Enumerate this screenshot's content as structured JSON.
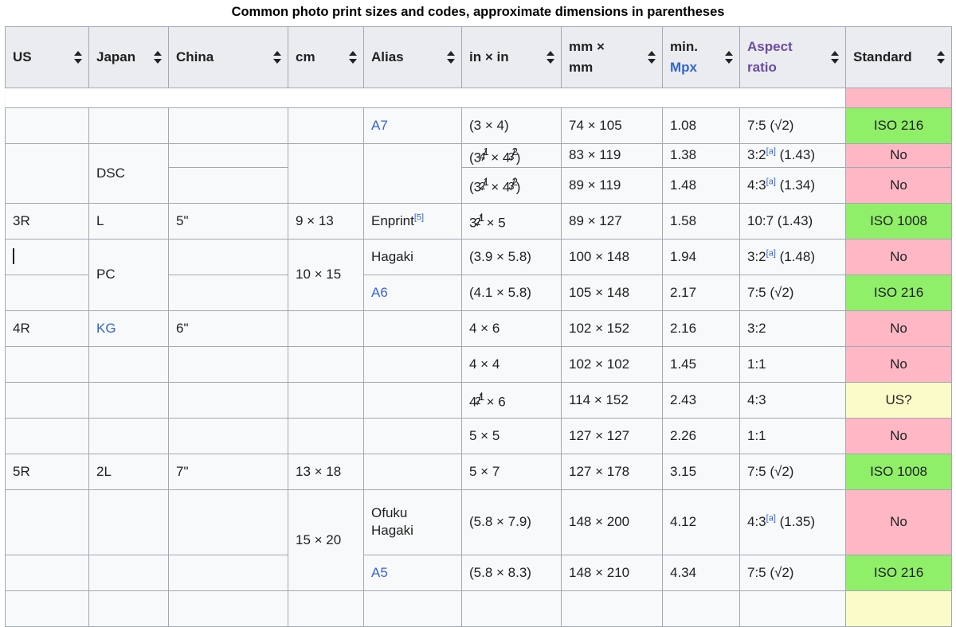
{
  "caption": "Common photo print sizes and codes, approximate dimensions in parentheses",
  "colors": {
    "header_bg": "#eaecf0",
    "cell_bg": "#f8f9fa",
    "border": "#a2a9b1",
    "link": "#3366cc",
    "link_visited": "#6b4ba1",
    "standard_yes": "#90ef69",
    "standard_no": "#ffb7c5",
    "standard_maybe": "#fbfbc9"
  },
  "headers": [
    {
      "label": "US",
      "sortable": true,
      "link": false
    },
    {
      "label": "Japan",
      "sortable": true,
      "link": false
    },
    {
      "label": "China",
      "sortable": true,
      "link": false
    },
    {
      "label": "cm",
      "sortable": true,
      "link": false
    },
    {
      "label": "Alias",
      "sortable": true,
      "link": false
    },
    {
      "label": "in × in",
      "sortable": true,
      "link": false
    },
    {
      "label": "mm × mm",
      "sortable": true,
      "link": false
    },
    {
      "label": "min. Mpx",
      "sortable": true,
      "link": "Mpx"
    },
    {
      "label": "Aspect ratio",
      "sortable": true,
      "link": "Aspect ratio"
    },
    {
      "label": "Standard",
      "sortable": true,
      "link": false
    }
  ],
  "header_parts": {
    "mm_line1": "mm ×",
    "mm_line2": "mm",
    "mpx_line1": "min.",
    "mpx_line2": "Mpx",
    "aspect_line1": "Aspect",
    "aspect_line2": "ratio"
  },
  "rows": [
    {
      "us": "",
      "japan": "",
      "china": "",
      "cm": "",
      "alias": "A7",
      "alias_link": true,
      "inin": "(3 × 4)",
      "mmmm": "74 × 105",
      "mpx": "1.08",
      "aspect": "7:5 (√2)",
      "standard": "ISO 216",
      "standard_state": "yes"
    },
    {
      "us": "",
      "japan": "DSC",
      "china": "",
      "cm": "",
      "alias": "",
      "inin": "(3¼ × 4⅔)",
      "mmmm": "83 × 119",
      "mpx": "1.38",
      "aspect": "3:2[a] (1.43)",
      "aspect_ref": "a",
      "standard": "No",
      "standard_state": "no"
    },
    {
      "us": "",
      "japan": "",
      "china": "",
      "cm": "",
      "alias": "",
      "inin": "(3½ × 4⅔)",
      "mmmm": "89 × 119",
      "mpx": "1.48",
      "aspect": "4:3[a] (1.34)",
      "aspect_ref": "a",
      "standard": "No",
      "standard_state": "no"
    },
    {
      "us": "3R",
      "japan": "L",
      "china": "5\"",
      "cm": "9 × 13",
      "alias": "Enprint",
      "alias_ref": "5",
      "inin": "3½ × 5",
      "mmmm": "89 × 127",
      "mpx": "1.58",
      "aspect": "10:7 (1.43)",
      "standard": "ISO 1008",
      "standard_state": "yes"
    },
    {
      "us": "",
      "us_caret": true,
      "japan": "PC",
      "china": "",
      "cm": "",
      "alias": "Hagaki",
      "inin": "(3.9 × 5.8)",
      "mmmm": "100 × 148",
      "mpx": "1.94",
      "aspect": "3:2[a] (1.48)",
      "aspect_ref": "a",
      "standard": "No",
      "standard_state": "no"
    },
    {
      "us": "",
      "japan": "",
      "china": "",
      "cm": "10 × 15",
      "alias": "A6",
      "alias_link": true,
      "inin": "(4.1 × 5.8)",
      "mmmm": "105 × 148",
      "mpx": "2.17",
      "aspect": "7:5 (√2)",
      "standard": "ISO 216",
      "standard_state": "yes"
    },
    {
      "us": "4R",
      "japan": "KG",
      "japan_link": true,
      "china": "6\"",
      "cm": "",
      "alias": "",
      "inin": "4 × 6",
      "mmmm": "102 × 152",
      "mpx": "2.16",
      "aspect": "3:2",
      "standard": "No",
      "standard_state": "no"
    },
    {
      "us": "",
      "japan": "",
      "china": "",
      "cm": "",
      "alias": "",
      "inin": "4 × 4",
      "mmmm": "102 × 102",
      "mpx": "1.45",
      "aspect": "1:1",
      "standard": "No",
      "standard_state": "no"
    },
    {
      "us": "",
      "japan": "",
      "china": "",
      "cm": "",
      "alias": "",
      "inin": "4½ × 6",
      "mmmm": "114 × 152",
      "mpx": "2.43",
      "aspect": "4:3",
      "standard": "US?",
      "standard_state": "maybe"
    },
    {
      "us": "",
      "japan": "",
      "china": "",
      "cm": "",
      "alias": "",
      "inin": "5 × 5",
      "mmmm": "127 × 127",
      "mpx": "2.26",
      "aspect": "1:1",
      "standard": "No",
      "standard_state": "no"
    },
    {
      "us": "5R",
      "japan": "2L",
      "china": "7\"",
      "cm": "13 × 18",
      "alias": "",
      "inin": "5 × 7",
      "mmmm": "127 × 178",
      "mpx": "3.15",
      "aspect": "7:5 (√2)",
      "standard": "ISO 1008",
      "standard_state": "yes"
    },
    {
      "us": "",
      "japan": "",
      "china": "",
      "cm": "",
      "alias": "Ofuku Hagaki",
      "inin": "(5.8 × 7.9)",
      "mmmm": "148 × 200",
      "mpx": "4.12",
      "aspect": "4:3[a] (1.35)",
      "aspect_ref": "a",
      "standard": "No",
      "standard_state": "no"
    },
    {
      "us": "",
      "japan": "",
      "china": "",
      "cm": "15 × 20",
      "alias": "A5",
      "alias_link": true,
      "inin": "(5.8 × 8.3)",
      "mmmm": "148 × 210",
      "mpx": "4.34",
      "aspect": "7:5 (√2)",
      "standard": "ISO 216",
      "standard_state": "yes"
    }
  ],
  "cell_texts": {
    "alias_enprint": "Enprint",
    "alias_hagaki": "Hagaki",
    "alias_ofuku_line1": "Ofuku",
    "alias_ofuku_line2": "Hagaki",
    "ref_5": "[5]",
    "ref_a": "[a]"
  }
}
